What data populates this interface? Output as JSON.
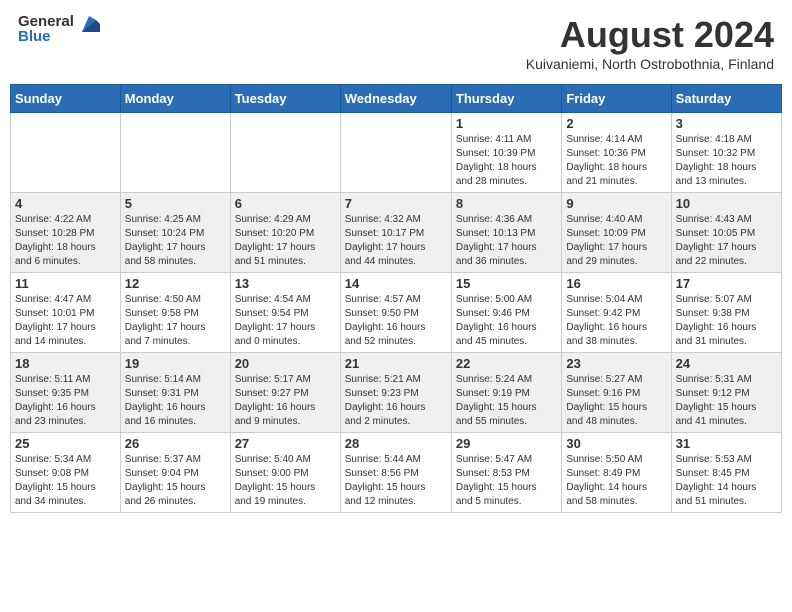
{
  "header": {
    "logo_general": "General",
    "logo_blue": "Blue",
    "month_year": "August 2024",
    "location": "Kuivaniemi, North Ostrobothnia, Finland"
  },
  "days_of_week": [
    "Sunday",
    "Monday",
    "Tuesday",
    "Wednesday",
    "Thursday",
    "Friday",
    "Saturday"
  ],
  "weeks": [
    [
      {
        "day": "",
        "info": ""
      },
      {
        "day": "",
        "info": ""
      },
      {
        "day": "",
        "info": ""
      },
      {
        "day": "",
        "info": ""
      },
      {
        "day": "1",
        "info": "Sunrise: 4:11 AM\nSunset: 10:39 PM\nDaylight: 18 hours\nand 28 minutes."
      },
      {
        "day": "2",
        "info": "Sunrise: 4:14 AM\nSunset: 10:36 PM\nDaylight: 18 hours\nand 21 minutes."
      },
      {
        "day": "3",
        "info": "Sunrise: 4:18 AM\nSunset: 10:32 PM\nDaylight: 18 hours\nand 13 minutes."
      }
    ],
    [
      {
        "day": "4",
        "info": "Sunrise: 4:22 AM\nSunset: 10:28 PM\nDaylight: 18 hours\nand 6 minutes."
      },
      {
        "day": "5",
        "info": "Sunrise: 4:25 AM\nSunset: 10:24 PM\nDaylight: 17 hours\nand 58 minutes."
      },
      {
        "day": "6",
        "info": "Sunrise: 4:29 AM\nSunset: 10:20 PM\nDaylight: 17 hours\nand 51 minutes."
      },
      {
        "day": "7",
        "info": "Sunrise: 4:32 AM\nSunset: 10:17 PM\nDaylight: 17 hours\nand 44 minutes."
      },
      {
        "day": "8",
        "info": "Sunrise: 4:36 AM\nSunset: 10:13 PM\nDaylight: 17 hours\nand 36 minutes."
      },
      {
        "day": "9",
        "info": "Sunrise: 4:40 AM\nSunset: 10:09 PM\nDaylight: 17 hours\nand 29 minutes."
      },
      {
        "day": "10",
        "info": "Sunrise: 4:43 AM\nSunset: 10:05 PM\nDaylight: 17 hours\nand 22 minutes."
      }
    ],
    [
      {
        "day": "11",
        "info": "Sunrise: 4:47 AM\nSunset: 10:01 PM\nDaylight: 17 hours\nand 14 minutes."
      },
      {
        "day": "12",
        "info": "Sunrise: 4:50 AM\nSunset: 9:58 PM\nDaylight: 17 hours\nand 7 minutes."
      },
      {
        "day": "13",
        "info": "Sunrise: 4:54 AM\nSunset: 9:54 PM\nDaylight: 17 hours\nand 0 minutes."
      },
      {
        "day": "14",
        "info": "Sunrise: 4:57 AM\nSunset: 9:50 PM\nDaylight: 16 hours\nand 52 minutes."
      },
      {
        "day": "15",
        "info": "Sunrise: 5:00 AM\nSunset: 9:46 PM\nDaylight: 16 hours\nand 45 minutes."
      },
      {
        "day": "16",
        "info": "Sunrise: 5:04 AM\nSunset: 9:42 PM\nDaylight: 16 hours\nand 38 minutes."
      },
      {
        "day": "17",
        "info": "Sunrise: 5:07 AM\nSunset: 9:38 PM\nDaylight: 16 hours\nand 31 minutes."
      }
    ],
    [
      {
        "day": "18",
        "info": "Sunrise: 5:11 AM\nSunset: 9:35 PM\nDaylight: 16 hours\nand 23 minutes."
      },
      {
        "day": "19",
        "info": "Sunrise: 5:14 AM\nSunset: 9:31 PM\nDaylight: 16 hours\nand 16 minutes."
      },
      {
        "day": "20",
        "info": "Sunrise: 5:17 AM\nSunset: 9:27 PM\nDaylight: 16 hours\nand 9 minutes."
      },
      {
        "day": "21",
        "info": "Sunrise: 5:21 AM\nSunset: 9:23 PM\nDaylight: 16 hours\nand 2 minutes."
      },
      {
        "day": "22",
        "info": "Sunrise: 5:24 AM\nSunset: 9:19 PM\nDaylight: 15 hours\nand 55 minutes."
      },
      {
        "day": "23",
        "info": "Sunrise: 5:27 AM\nSunset: 9:16 PM\nDaylight: 15 hours\nand 48 minutes."
      },
      {
        "day": "24",
        "info": "Sunrise: 5:31 AM\nSunset: 9:12 PM\nDaylight: 15 hours\nand 41 minutes."
      }
    ],
    [
      {
        "day": "25",
        "info": "Sunrise: 5:34 AM\nSunset: 9:08 PM\nDaylight: 15 hours\nand 34 minutes."
      },
      {
        "day": "26",
        "info": "Sunrise: 5:37 AM\nSunset: 9:04 PM\nDaylight: 15 hours\nand 26 minutes."
      },
      {
        "day": "27",
        "info": "Sunrise: 5:40 AM\nSunset: 9:00 PM\nDaylight: 15 hours\nand 19 minutes."
      },
      {
        "day": "28",
        "info": "Sunrise: 5:44 AM\nSunset: 8:56 PM\nDaylight: 15 hours\nand 12 minutes."
      },
      {
        "day": "29",
        "info": "Sunrise: 5:47 AM\nSunset: 8:53 PM\nDaylight: 15 hours\nand 5 minutes."
      },
      {
        "day": "30",
        "info": "Sunrise: 5:50 AM\nSunset: 8:49 PM\nDaylight: 14 hours\nand 58 minutes."
      },
      {
        "day": "31",
        "info": "Sunrise: 5:53 AM\nSunset: 8:45 PM\nDaylight: 14 hours\nand 51 minutes."
      }
    ]
  ]
}
